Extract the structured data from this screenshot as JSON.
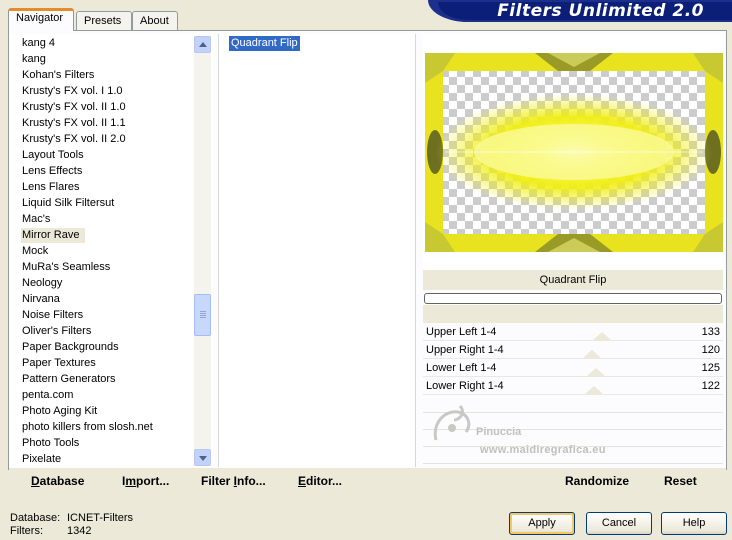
{
  "tabs": [
    {
      "label": "Navigator",
      "active": true
    },
    {
      "label": "Presets",
      "active": false
    },
    {
      "label": "About",
      "active": false
    }
  ],
  "app_title": "Filters Unlimited 2.0",
  "categories": [
    "kang 4",
    "kang",
    "Kohan's Filters",
    "Krusty's FX vol. I 1.0",
    "Krusty's FX vol. II 1.0",
    "Krusty's FX vol. II 1.1",
    "Krusty's FX vol. II 2.0",
    "Layout Tools",
    "Lens Effects",
    "Lens Flares",
    "Liquid Silk Filtersut",
    "Mac's",
    "Mirror Rave",
    "Mock",
    "MuRa's Seamless",
    "Neology",
    "Nirvana",
    "Noise Filters",
    "Oliver's Filters",
    "Paper Backgrounds",
    "Paper Textures",
    "Pattern Generators",
    "penta.com",
    "Photo Aging Kit",
    "photo killers from slosh.net",
    "Photo Tools",
    "Pixelate"
  ],
  "selected_category": "Mirror Rave",
  "filters": [
    "Quadrant Flip"
  ],
  "selected_filter": "Quadrant Flip",
  "preview": {
    "filter_name": "Quadrant Flip",
    "progress": 0
  },
  "sliders": [
    {
      "label": "Upper Left 1-4",
      "value": "133",
      "level": 0.52
    },
    {
      "label": "Upper Right 1-4",
      "value": "120",
      "level": 0.47
    },
    {
      "label": "Lower Left 1-4",
      "value": "125",
      "level": 0.49
    },
    {
      "label": "Lower Right 1-4",
      "value": "122",
      "level": 0.48
    }
  ],
  "watermark": {
    "line1": "Pinuccia",
    "line2": "www.maidiregrafica.eu"
  },
  "actions": {
    "database": {
      "underline": "D",
      "rest": "atabase"
    },
    "import": {
      "pre": "I",
      "underline": "m",
      "rest": "port..."
    },
    "filter_info": {
      "pre": "Filter ",
      "underline": "I",
      "rest": "nfo..."
    },
    "editor": {
      "underline": "E",
      "rest": "ditor..."
    },
    "randomize": "Randomize",
    "reset": "Reset"
  },
  "status": {
    "database_label": "Database:",
    "database_value": "ICNET-Filters",
    "filters_label": "Filters:",
    "filters_value": "1342"
  },
  "buttons": {
    "apply": "Apply",
    "cancel": "Cancel",
    "help": "Help"
  },
  "colors": {
    "selection": "#316ac5",
    "banner": "#0b1f78",
    "preview_yellow": "#f4f000",
    "preview_olive": "#8a8a20"
  }
}
